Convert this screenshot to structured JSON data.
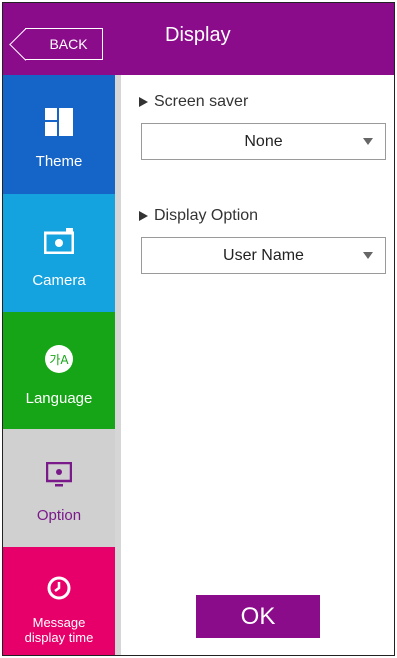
{
  "header": {
    "back_label": "BACK",
    "title": "Display"
  },
  "sidebar": {
    "items": [
      {
        "label": "Theme",
        "icon": "theme-icon",
        "color": "#1565c8"
      },
      {
        "label": "Camera",
        "icon": "camera-icon",
        "color": "#15a3e0"
      },
      {
        "label": "Language",
        "icon": "language-icon",
        "color": "#16a516",
        "icon_text": "가A"
      },
      {
        "label": "Option",
        "icon": "option-icon",
        "color": "#d0d0d0",
        "selected": true
      },
      {
        "label": "Message\ndisplay time",
        "icon": "clock-icon",
        "color": "#e8006a"
      }
    ]
  },
  "main": {
    "screen_saver": {
      "label": "Screen saver",
      "value": "None"
    },
    "display_option": {
      "label": "Display Option",
      "value": "User Name"
    },
    "ok_label": "OK"
  },
  "colors": {
    "accent": "#8b0c8b"
  }
}
